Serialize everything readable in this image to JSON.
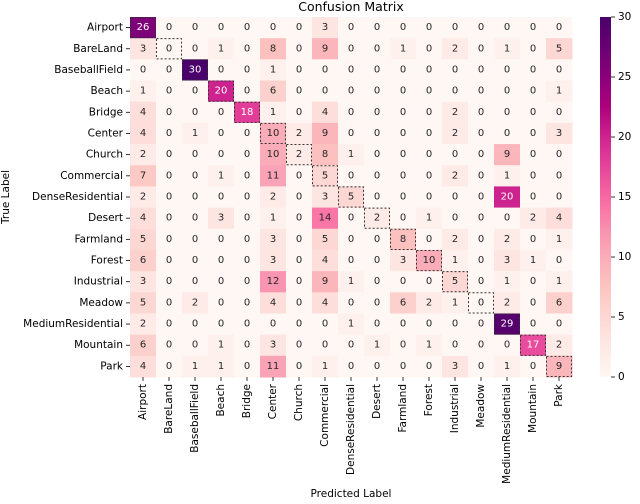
{
  "chart_data": {
    "type": "heatmap",
    "title": "Confusion Matrix",
    "xlabel": "Predicted Label",
    "ylabel": "True Label",
    "x_categories": [
      "Airport",
      "BareLand",
      "BaseballField",
      "Beach",
      "Bridge",
      "Center",
      "Church",
      "Commercial",
      "DenseResidential",
      "Desert",
      "Farmland",
      "Forest",
      "Industrial",
      "Meadow",
      "MediumResidential",
      "Mountain",
      "Park"
    ],
    "y_categories": [
      "Airport",
      "BareLand",
      "BaseballField",
      "Beach",
      "Bridge",
      "Center",
      "Church",
      "Commercial",
      "DenseResidential",
      "Desert",
      "Farmland",
      "Forest",
      "Industrial",
      "Meadow",
      "MediumResidential",
      "Mountain",
      "Park"
    ],
    "values": [
      [
        26,
        0,
        0,
        0,
        0,
        0,
        0,
        3,
        0,
        0,
        0,
        0,
        0,
        0,
        0,
        0,
        0
      ],
      [
        3,
        0,
        0,
        1,
        0,
        8,
        0,
        9,
        0,
        0,
        1,
        0,
        2,
        0,
        1,
        0,
        5
      ],
      [
        0,
        0,
        30,
        0,
        0,
        1,
        0,
        0,
        0,
        0,
        0,
        0,
        0,
        0,
        0,
        0,
        0
      ],
      [
        1,
        0,
        0,
        20,
        0,
        6,
        0,
        0,
        0,
        0,
        0,
        0,
        0,
        0,
        0,
        0,
        1
      ],
      [
        4,
        0,
        0,
        0,
        18,
        1,
        0,
        4,
        0,
        0,
        0,
        0,
        2,
        0,
        0,
        0,
        0
      ],
      [
        4,
        0,
        1,
        0,
        0,
        10,
        2,
        9,
        0,
        0,
        0,
        0,
        2,
        0,
        0,
        0,
        3
      ],
      [
        2,
        0,
        0,
        0,
        0,
        10,
        2,
        8,
        1,
        0,
        0,
        0,
        0,
        0,
        9,
        0,
        0
      ],
      [
        7,
        0,
        0,
        1,
        0,
        11,
        0,
        5,
        0,
        0,
        0,
        0,
        2,
        0,
        1,
        0,
        0
      ],
      [
        2,
        0,
        0,
        0,
        0,
        2,
        0,
        3,
        5,
        0,
        0,
        0,
        0,
        0,
        20,
        0,
        0
      ],
      [
        4,
        0,
        0,
        3,
        0,
        1,
        0,
        14,
        0,
        2,
        0,
        1,
        0,
        0,
        0,
        2,
        4
      ],
      [
        5,
        0,
        0,
        0,
        0,
        3,
        0,
        5,
        0,
        0,
        8,
        0,
        2,
        0,
        2,
        0,
        1
      ],
      [
        6,
        0,
        0,
        0,
        0,
        3,
        0,
        4,
        0,
        0,
        3,
        10,
        1,
        0,
        3,
        1,
        0
      ],
      [
        3,
        0,
        0,
        0,
        0,
        12,
        0,
        9,
        1,
        0,
        0,
        0,
        5,
        0,
        1,
        0,
        1
      ],
      [
        5,
        0,
        2,
        0,
        0,
        4,
        0,
        4,
        0,
        0,
        6,
        2,
        1,
        0,
        2,
        0,
        6
      ],
      [
        2,
        0,
        0,
        0,
        0,
        0,
        0,
        0,
        1,
        0,
        0,
        0,
        0,
        0,
        29,
        0,
        0
      ],
      [
        6,
        0,
        0,
        1,
        0,
        3,
        0,
        0,
        0,
        1,
        0,
        1,
        0,
        0,
        0,
        17,
        2
      ],
      [
        4,
        0,
        1,
        1,
        0,
        11,
        0,
        1,
        0,
        0,
        0,
        0,
        3,
        0,
        1,
        0,
        9
      ]
    ],
    "colormap": "RdPu",
    "color_range": [
      0,
      30
    ],
    "colorbar_ticks": [
      0,
      5,
      10,
      15,
      20,
      25,
      30
    ],
    "diagonal_highlight": "dashed-border",
    "grid": false
  }
}
